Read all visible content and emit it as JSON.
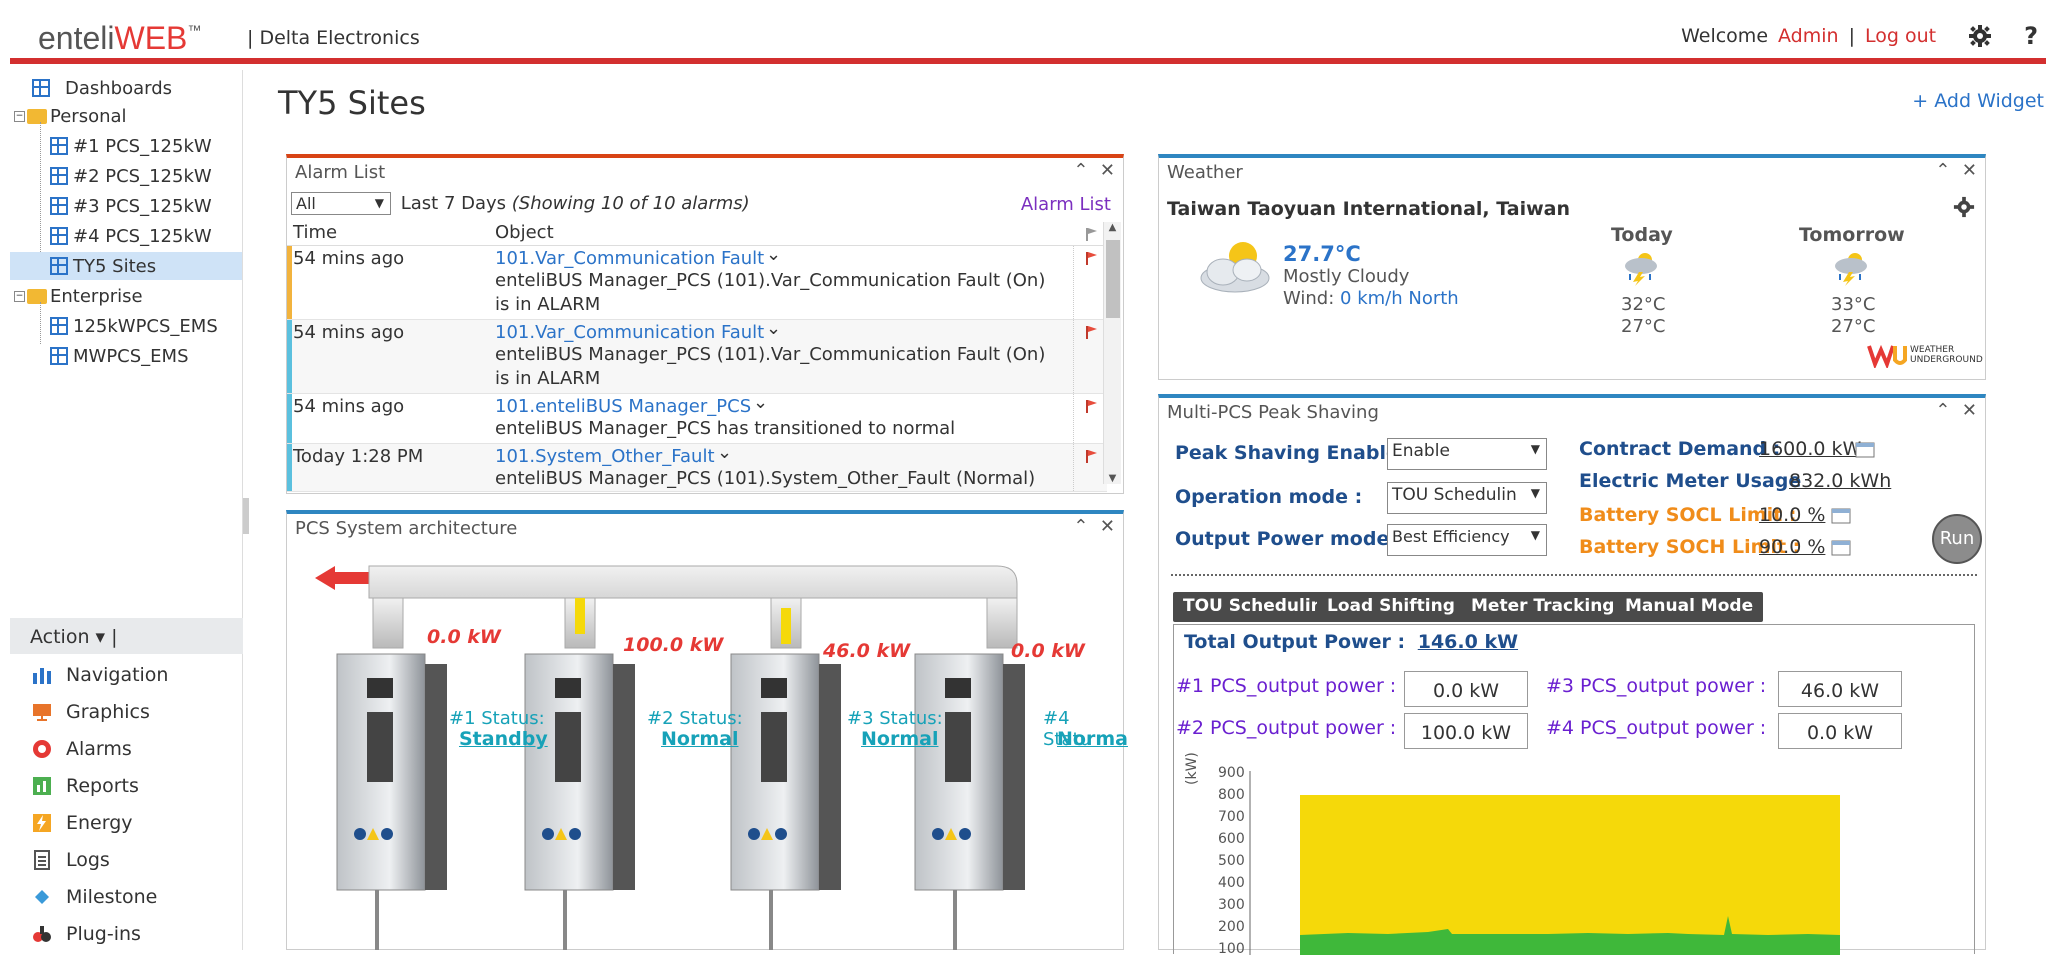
{
  "header": {
    "logo_prefix": "enteli",
    "logo_suffix": "WEB",
    "logo_tm": "™",
    "company": "| Delta Electronics",
    "welcome": "Welcome",
    "user": "Admin",
    "separator": "|",
    "logout": "Log out",
    "help": "?"
  },
  "sidebar": {
    "dashboards": "Dashboards",
    "personal": "Personal",
    "personal_items": [
      "#1 PCS_125kW",
      "#2 PCS_125kW",
      "#3 PCS_125kW",
      "#4 PCS_125kW",
      "TY5 Sites"
    ],
    "enterprise": "Enterprise",
    "enterprise_items": [
      "125kWPCS_EMS",
      "MWPCS_EMS"
    ],
    "action": "Action ▾ |",
    "nav": [
      "Navigation",
      "Graphics",
      "Alarms",
      "Reports",
      "Energy",
      "Logs",
      "Milestone",
      "Plug-ins"
    ]
  },
  "page": {
    "title": "TY5 Sites",
    "add_widget": "+ Add Widget"
  },
  "alarm_list": {
    "title": "Alarm List",
    "filter": "All",
    "range": "Last 7 Days",
    "showing": "(Showing 10 of 10 alarms)",
    "link": "Alarm List",
    "col_time": "Time",
    "col_object": "Object",
    "rows": [
      {
        "time": "54 mins ago",
        "name": "101.Var_Communication Fault",
        "desc1": "enteliBUS Manager_PCS (101).Var_Communication Fault (On)",
        "desc2": "is in ALARM",
        "color": "#f2b33d"
      },
      {
        "time": "54 mins ago",
        "name": "101.Var_Communication Fault",
        "desc1": "enteliBUS Manager_PCS (101).Var_Communication Fault (On)",
        "desc2": "is in ALARM",
        "color": "#5bc0de"
      },
      {
        "time": "54 mins ago",
        "name": "101.enteliBUS Manager_PCS",
        "desc1": "enteliBUS Manager_PCS has transitioned to normal",
        "desc2": "",
        "color": "#5bc0de"
      },
      {
        "time": "Today 1:28 PM",
        "name": "101.System_Other_Fault",
        "desc1": "enteliBUS Manager_PCS (101).System_Other_Fault (Normal)",
        "desc2": "",
        "color": "#5bc0de"
      }
    ]
  },
  "weather": {
    "title": "Weather",
    "location": "Taiwan Taoyuan International, Taiwan",
    "temp": "27.7°C",
    "condition": "Mostly Cloudy",
    "wind_label": "Wind:",
    "wind": "0 km/h North",
    "today": "Today",
    "tomorrow": "Tomorrow",
    "today_hi": "32°C",
    "today_lo": "27°C",
    "tomorrow_hi": "33°C",
    "tomorrow_lo": "27°C",
    "brand_line1": "WEATHER",
    "brand_line2": "UNDERGROUND"
  },
  "pcs_arch": {
    "title": "PCS System architecture",
    "units": [
      {
        "power": "0.0 kW",
        "status_label": "#1 Status:",
        "status": "Standby"
      },
      {
        "power": "100.0 kW",
        "status_label": "#2 Status:",
        "status": "Normal"
      },
      {
        "power": "46.0 kW",
        "status_label": "#3 Status:",
        "status": "Normal"
      },
      {
        "power": "0.0 kW",
        "status_label": "#4 Statu",
        "status": "Norma"
      }
    ]
  },
  "peak": {
    "title": "Multi-PCS Peak Shaving",
    "enable_label": "Peak Shaving Enable",
    "enable_value": "Enable",
    "op_label": "Operation mode :",
    "op_value": "TOU Schedulin",
    "out_label": "Output Power mode :",
    "out_value": "Best Efficiency",
    "contract_label": "Contract Demand :",
    "contract_value": "1600.0 kW",
    "meter_label": "Electric Meter Usage",
    "meter_value": "832.0 kWh",
    "socl_label": "Battery SOCL Limit :",
    "socl_value": "10.0 %",
    "soch_label": "Battery SOCH Limit :",
    "soch_value": "90.0 %",
    "run": "Run",
    "tabs": [
      "TOU Scheduling",
      "Load Shifting",
      "Meter Tracking",
      "Manual Mode"
    ],
    "total_label": "Total Output Power :",
    "total_value": "146.0 kW",
    "p1_label": "#1 PCS_output power :",
    "p1": "0.0 kW",
    "p2_label": "#2 PCS_output power :",
    "p2": "100.0 kW",
    "p3_label": "#3 PCS_output power :",
    "p3": "46.0 kW",
    "p4_label": "#4 PCS_output power :",
    "p4": "0.0 kW",
    "chart_unit": "(kW)",
    "y_ticks": [
      "900",
      "800",
      "700",
      "600",
      "500",
      "400",
      "300",
      "200",
      "100"
    ]
  },
  "colors": {
    "accent_red": "#d32f2f",
    "link_blue": "#2b73c8",
    "power_red": "#e53935",
    "status_teal": "#17a2b8",
    "chart_yellow": "#f5d90a",
    "chart_green": "#3fb83a"
  }
}
